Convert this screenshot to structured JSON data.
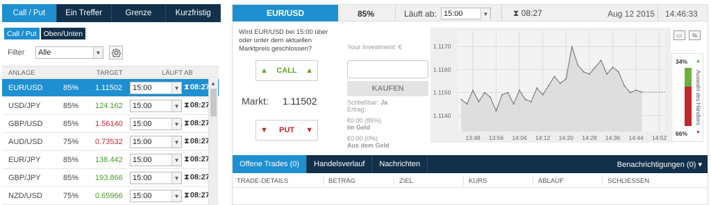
{
  "left": {
    "top_tabs": [
      "Call / Put",
      "Ein Treffer",
      "Grenze",
      "Kurzfristig"
    ],
    "sub_tabs": [
      "Call / Put",
      "Oben/Unten"
    ],
    "filter_label": "Filter",
    "filter_value": "Alle",
    "headers": {
      "asset": "ANLAGE",
      "target": "TARGET",
      "expiry": "LÄUFT AB"
    },
    "rows": [
      {
        "asset": "EUR/USD",
        "pct": "85%",
        "target": "1.11502",
        "dir": "flat",
        "time": "15:00",
        "countdown": "08:27"
      },
      {
        "asset": "USD/JPY",
        "pct": "85%",
        "target": "124.162",
        "dir": "up",
        "time": "15:00",
        "countdown": "08:27"
      },
      {
        "asset": "GBP/USD",
        "pct": "85%",
        "target": "1.56140",
        "dir": "down",
        "time": "15:00",
        "countdown": "08:27"
      },
      {
        "asset": "AUD/USD",
        "pct": "75%",
        "target": "0.73532",
        "dir": "down",
        "time": "15:00",
        "countdown": "08:27"
      },
      {
        "asset": "EUR/JPY",
        "pct": "85%",
        "target": "138.442",
        "dir": "up",
        "time": "15:00",
        "countdown": "08:27"
      },
      {
        "asset": "GBP/JPY",
        "pct": "85%",
        "target": "193.866",
        "dir": "up",
        "time": "15:00",
        "countdown": "08:27"
      },
      {
        "asset": "NZD/USD",
        "pct": "75%",
        "target": "0.65966",
        "dir": "up",
        "time": "15:00",
        "countdown": "08:27"
      }
    ]
  },
  "right": {
    "pair": "EUR/USD",
    "payout": "85%",
    "expiry_label": "Läuft ab:",
    "expiry_value": "15:00",
    "countdown": "08:27",
    "date": "Aug 12 2015",
    "time": "14:46:33",
    "question": "Wird EUR/USD bei 15:00 über oder unter dem aktuellen Marktpreis geschlossen?",
    "call_label": "CALL",
    "put_label": "PUT",
    "market_label": "Markt:",
    "market_value": "1.11502",
    "investment_label": "Your Investment: €",
    "buy_label": "KAUFEN",
    "closable_label": "Schließbar:",
    "closable_value": "Ja",
    "yield_label": "Ertrag:",
    "in_money_value": "€0.00 (85%)",
    "in_money_label": "Im Geld",
    "out_money_value": "€0.00 (0%)",
    "out_money_label": "Aus dem Geld",
    "sentiment_high": "34%",
    "sentiment_low": "66%",
    "sentiment_text": "Auswahl des Händlers",
    "tool_pct": "%"
  },
  "bottom": {
    "tabs": [
      "Offene Trades (0)",
      "Handelsverlauf",
      "Nachrichten"
    ],
    "notifications": "Benachrichtigungen (0) ▾",
    "columns": [
      "TRADE-DETAILS",
      "BETRAG",
      "ZIEL",
      "KURS",
      "ABLAUF",
      "SCHLIESSEN"
    ]
  },
  "chart_data": {
    "type": "area",
    "x": [
      "13:44",
      "13:46",
      "13:48",
      "13:50",
      "13:52",
      "13:54",
      "13:56",
      "13:58",
      "14:00",
      "14:02",
      "14:04",
      "14:06",
      "14:08",
      "14:10",
      "14:12",
      "14:14",
      "14:16",
      "14:18",
      "14:20",
      "14:22",
      "14:24",
      "14:26",
      "14:28",
      "14:30",
      "14:32",
      "14:34",
      "14:36",
      "14:38",
      "14:40",
      "14:42",
      "14:44",
      "14:46"
    ],
    "y": [
      1.1147,
      1.1145,
      1.1151,
      1.1146,
      1.115,
      1.1148,
      1.1142,
      1.1149,
      1.115,
      1.1145,
      1.1151,
      1.1147,
      1.1146,
      1.1152,
      1.1149,
      1.1153,
      1.1157,
      1.1154,
      1.1156,
      1.117,
      1.1162,
      1.1159,
      1.1158,
      1.1161,
      1.1164,
      1.1158,
      1.1161,
      1.1159,
      1.1153,
      1.115,
      1.1151,
      1.11502
    ],
    "x_ticks": [
      "13:48",
      "13:56",
      "14:04",
      "14:12",
      "14:20",
      "14:28",
      "14:36",
      "14:44",
      "14:52"
    ],
    "y_ticks": [
      "1.1140",
      "1.1150",
      "1.1160",
      "1.1170"
    ],
    "ylim": [
      1.1133,
      1.1177
    ],
    "xlim": [
      "13:43",
      "14:54"
    ],
    "grid": true,
    "colors": {
      "line": "#6b6b6b",
      "fill": "#d9d9d9",
      "background": "#eeeeee"
    }
  }
}
